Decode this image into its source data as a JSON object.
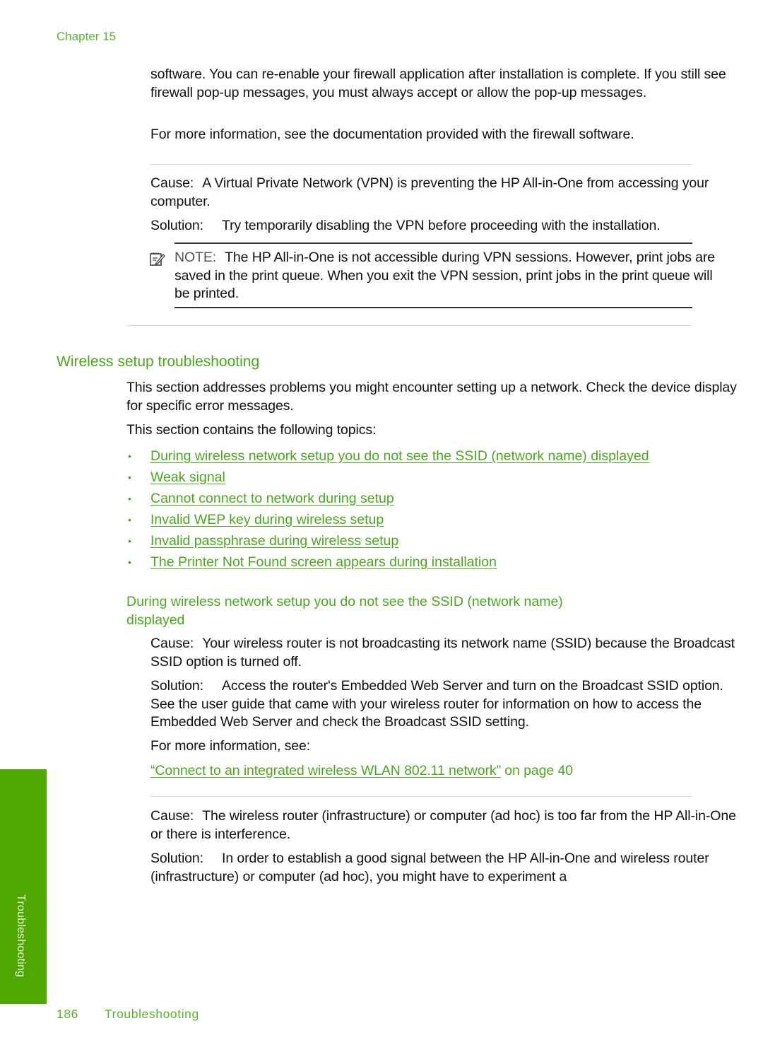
{
  "header": {
    "chapter": "Chapter 15"
  },
  "firewall_section": {
    "para1": "software. You can re-enable your firewall application after installation is complete. If you still see firewall pop-up messages, you must always accept or allow the pop-up messages.",
    "para2": "For more information, see the documentation provided with the firewall software."
  },
  "vpn_section": {
    "cause_label": "Cause:",
    "cause_text": "A Virtual Private Network (VPN) is preventing the HP All-in-One from accessing your computer.",
    "solution_label": "Solution:",
    "solution_text": "Try temporarily disabling the VPN before proceeding with the installation.",
    "note_label": "NOTE:",
    "note_text": "The HP All-in-One is not accessible during VPN sessions. However, print jobs are saved in the print queue. When you exit the VPN session, print jobs in the print queue will be printed.",
    "note_icon": "note-pencil-icon"
  },
  "wireless_section": {
    "heading": "Wireless setup troubleshooting",
    "intro": "This section addresses problems you might encounter setting up a network. Check the device display for specific error messages.",
    "topics_intro": "This section contains the following topics:",
    "topics": [
      {
        "label": "During wireless network setup you do not see the SSID (network name) displayed"
      },
      {
        "label": "Weak signal"
      },
      {
        "label": "Cannot connect to network during setup"
      },
      {
        "label": "Invalid WEP key during wireless setup"
      },
      {
        "label": "Invalid passphrase during wireless setup"
      },
      {
        "label": "The Printer Not Found screen appears during installation"
      }
    ]
  },
  "ssid_section": {
    "heading": "During wireless network setup you do not see the SSID (network name) displayed",
    "cause_label": "Cause:",
    "cause_text": "Your wireless router is not broadcasting its network name (SSID) because the Broadcast SSID option is turned off.",
    "solution_label": "Solution:",
    "solution_text": "Access the router's Embedded Web Server and turn on the Broadcast SSID option. See the user guide that came with your wireless router for information on how to access the Embedded Web Server and check the Broadcast SSID setting.",
    "more_info": "For more information, see:",
    "link_text": "“Connect to an integrated wireless WLAN 802.11 network”",
    "link_suffix": " on page 40",
    "cause2_label": "Cause:",
    "cause2_text": "The wireless router (infrastructure) or computer (ad hoc) is too far from the HP All-in-One or there is interference.",
    "solution2_label": "Solution:",
    "solution2_text": "In order to establish a good signal between the HP All-in-One and wireless router (infrastructure) or computer (ad hoc), you might have to experiment a"
  },
  "side_tab": {
    "label": "Troubleshooting"
  },
  "footer": {
    "page_number": "186",
    "section": "Troubleshooting"
  },
  "colors": {
    "accent_green": "#4aa81c",
    "tab_green": "#4ea800"
  }
}
